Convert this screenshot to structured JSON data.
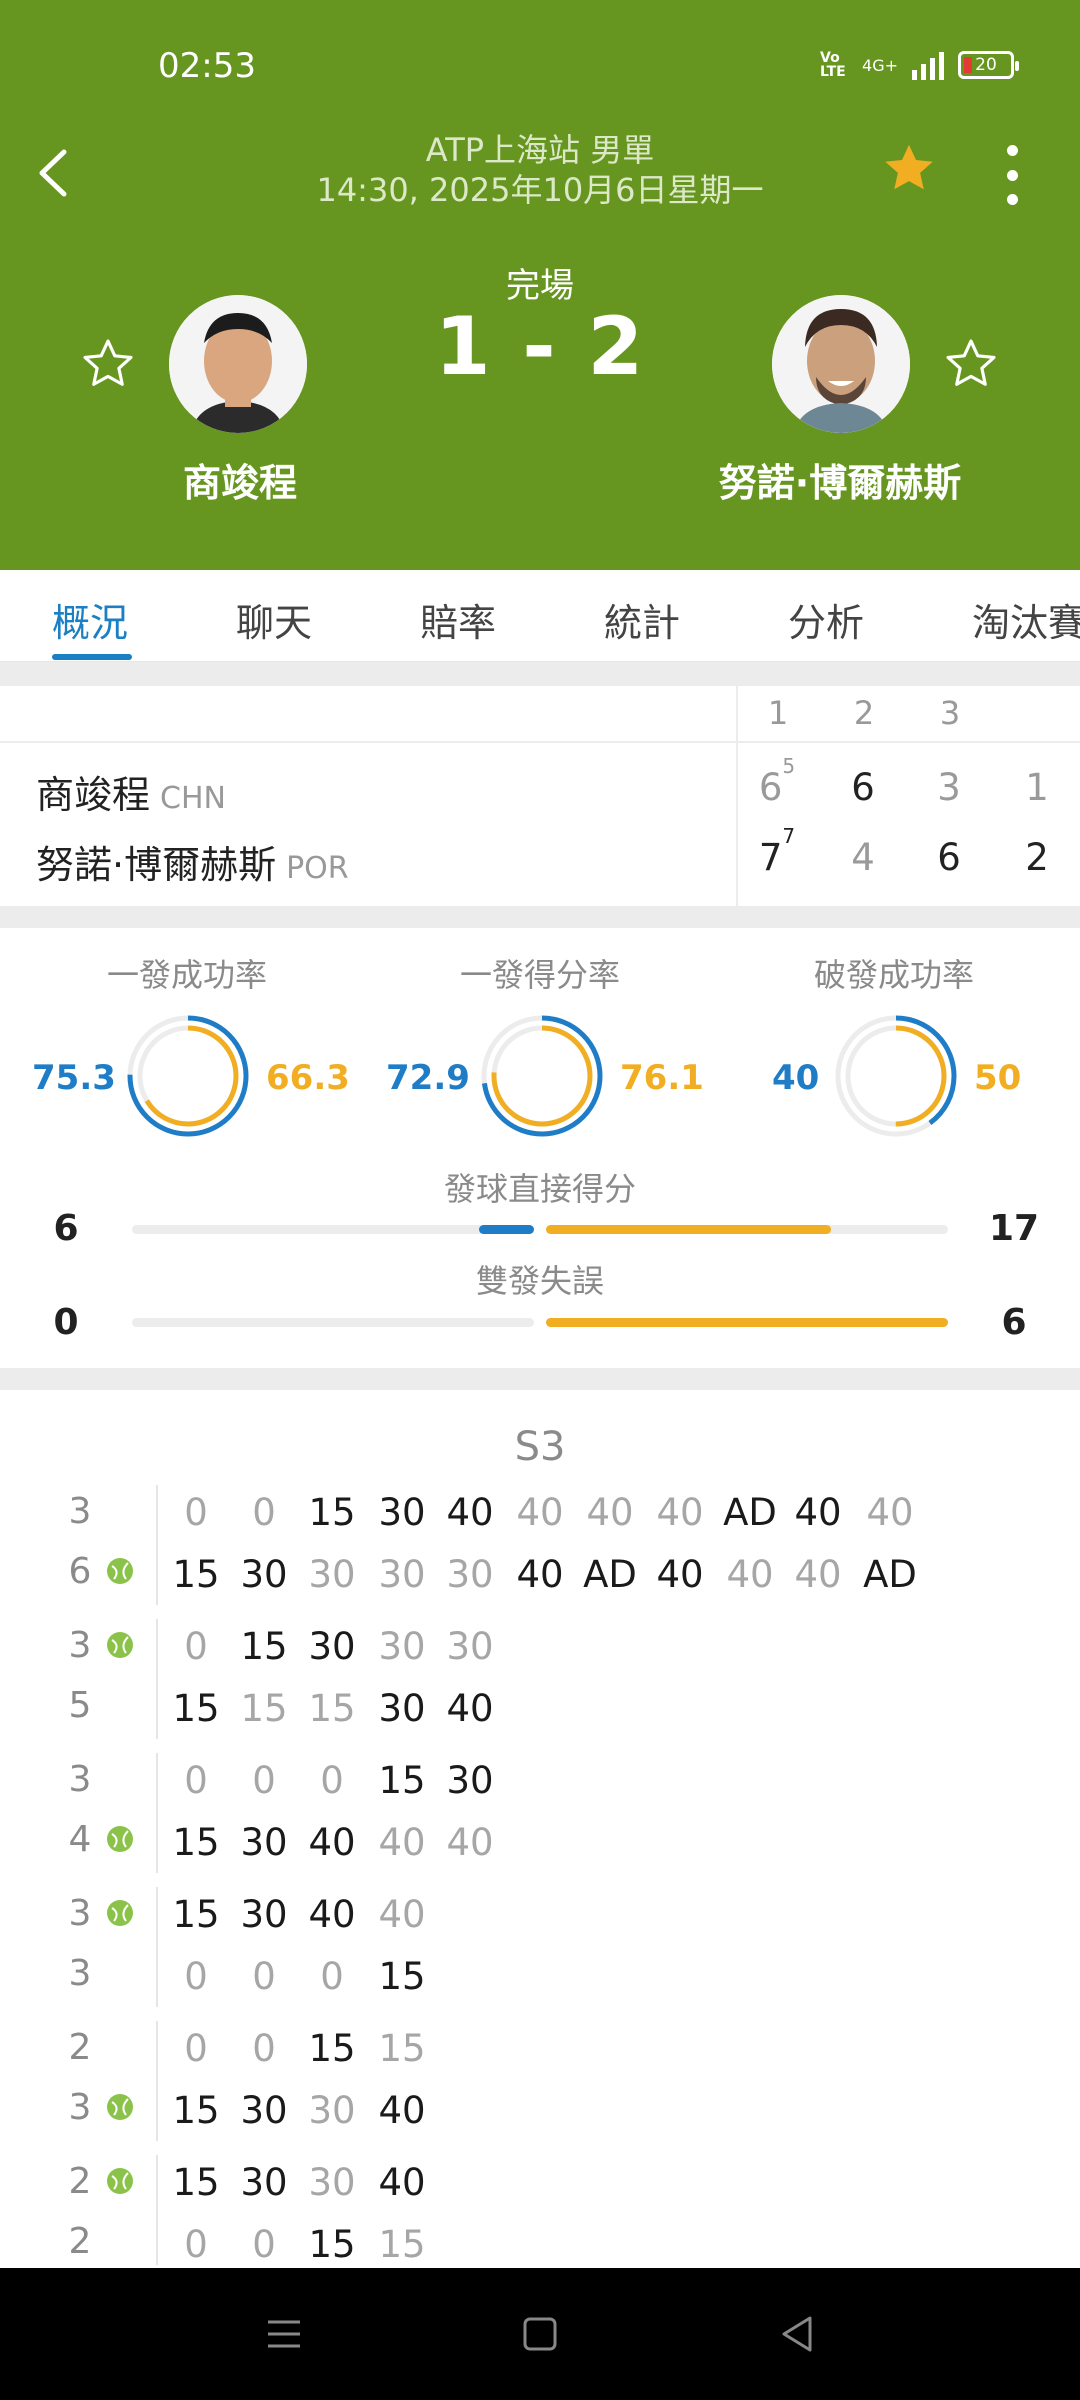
{
  "status_bar": {
    "time": "02:53",
    "volte": "Vo LTE",
    "network": "4G+",
    "battery": "20"
  },
  "header": {
    "tournament": "ATP上海站 男單",
    "datetime": "14:30, 2025年10月6日星期一",
    "match_status": "完場",
    "score": "1 - 2",
    "accent_color": "#66961f",
    "player1": {
      "name": "商竣程"
    },
    "player2": {
      "name": "努諾·博爾赫斯"
    }
  },
  "tabs": [
    {
      "label": "概況",
      "active": true
    },
    {
      "label": "聊天"
    },
    {
      "label": "賠率"
    },
    {
      "label": "統計"
    },
    {
      "label": "分析"
    },
    {
      "label": "淘汰賽"
    }
  ],
  "score_table": {
    "set_headers": [
      "1",
      "2",
      "3"
    ],
    "player1": {
      "name": "商竣程",
      "country": "CHN",
      "sets": [
        "6",
        "6",
        "3"
      ],
      "tiebreak1": "5",
      "current": "1"
    },
    "player2": {
      "name": "努諾·博爾赫斯",
      "country": "POR",
      "sets": [
        "7",
        "4",
        "6"
      ],
      "tiebreak1": "7",
      "current": "2"
    }
  },
  "stats": {
    "rings": [
      {
        "label": "一發成功率",
        "p1": "75.3",
        "p2": "66.3",
        "p1_fraction": 0.753,
        "p2_fraction": 0.663
      },
      {
        "label": "一發得分率",
        "p1": "72.9",
        "p2": "76.1",
        "p1_fraction": 0.729,
        "p2_fraction": 0.761
      },
      {
        "label": "破發成功率",
        "p1": "40",
        "p2": "50",
        "p1_fraction": 0.4,
        "p2_fraction": 0.5
      }
    ],
    "bars": [
      {
        "label": "發球直接得分",
        "p1": "6",
        "p2": "17"
      },
      {
        "label": "雙發失誤",
        "p1": "0",
        "p2": "6"
      }
    ]
  },
  "point_by_point": {
    "set_label": "S3",
    "games": [
      {
        "top_score": "3",
        "bottom_score": "6",
        "ball": "bottom",
        "top": [
          [
            "0",
            "g"
          ],
          [
            "0",
            "g"
          ],
          [
            "15",
            "d"
          ],
          [
            "30",
            "d"
          ],
          [
            "40",
            "d"
          ],
          [
            "40",
            "g"
          ],
          [
            "40",
            "g"
          ],
          [
            "40",
            "g"
          ],
          [
            "AD",
            "d"
          ],
          [
            "40",
            "d"
          ],
          [
            "40",
            "g"
          ]
        ],
        "bottom": [
          [
            "15",
            "d"
          ],
          [
            "30",
            "d"
          ],
          [
            "30",
            "g"
          ],
          [
            "30",
            "g"
          ],
          [
            "30",
            "g"
          ],
          [
            "40",
            "d"
          ],
          [
            "AD",
            "d"
          ],
          [
            "40",
            "d"
          ],
          [
            "40",
            "g"
          ],
          [
            "40",
            "g"
          ],
          [
            "AD",
            "d"
          ]
        ]
      },
      {
        "top_score": "3",
        "bottom_score": "5",
        "ball": "top",
        "top": [
          [
            "0",
            "g"
          ],
          [
            "15",
            "d"
          ],
          [
            "30",
            "d"
          ],
          [
            "30",
            "g"
          ],
          [
            "30",
            "g"
          ]
        ],
        "bottom": [
          [
            "15",
            "d"
          ],
          [
            "15",
            "g"
          ],
          [
            "15",
            "g"
          ],
          [
            "30",
            "d"
          ],
          [
            "40",
            "d"
          ]
        ]
      },
      {
        "top_score": "3",
        "bottom_score": "4",
        "ball": "bottom",
        "top": [
          [
            "0",
            "g"
          ],
          [
            "0",
            "g"
          ],
          [
            "0",
            "g"
          ],
          [
            "15",
            "d"
          ],
          [
            "30",
            "d"
          ]
        ],
        "bottom": [
          [
            "15",
            "d"
          ],
          [
            "30",
            "d"
          ],
          [
            "40",
            "d"
          ],
          [
            "40",
            "g"
          ],
          [
            "40",
            "g"
          ]
        ]
      },
      {
        "top_score": "3",
        "bottom_score": "3",
        "ball": "top",
        "top": [
          [
            "15",
            "d"
          ],
          [
            "30",
            "d"
          ],
          [
            "40",
            "d"
          ],
          [
            "40",
            "g"
          ]
        ],
        "bottom": [
          [
            "0",
            "g"
          ],
          [
            "0",
            "g"
          ],
          [
            "0",
            "g"
          ],
          [
            "15",
            "d"
          ]
        ]
      },
      {
        "top_score": "2",
        "bottom_score": "3",
        "ball": "bottom",
        "top": [
          [
            "0",
            "g"
          ],
          [
            "0",
            "g"
          ],
          [
            "15",
            "d"
          ],
          [
            "15",
            "g"
          ]
        ],
        "bottom": [
          [
            "15",
            "d"
          ],
          [
            "30",
            "d"
          ],
          [
            "30",
            "g"
          ],
          [
            "40",
            "d"
          ]
        ]
      },
      {
        "top_score": "2",
        "bottom_score": "2",
        "ball": "top",
        "top": [
          [
            "15",
            "d"
          ],
          [
            "30",
            "d"
          ],
          [
            "30",
            "g"
          ],
          [
            "40",
            "d"
          ]
        ],
        "bottom": [
          [
            "0",
            "g"
          ],
          [
            "0",
            "g"
          ],
          [
            "15",
            "d"
          ],
          [
            "15",
            "g"
          ]
        ]
      }
    ]
  },
  "colors": {
    "p1": "#1f7dc7",
    "p2": "#f2ae22",
    "ball": "#8bc34a"
  }
}
